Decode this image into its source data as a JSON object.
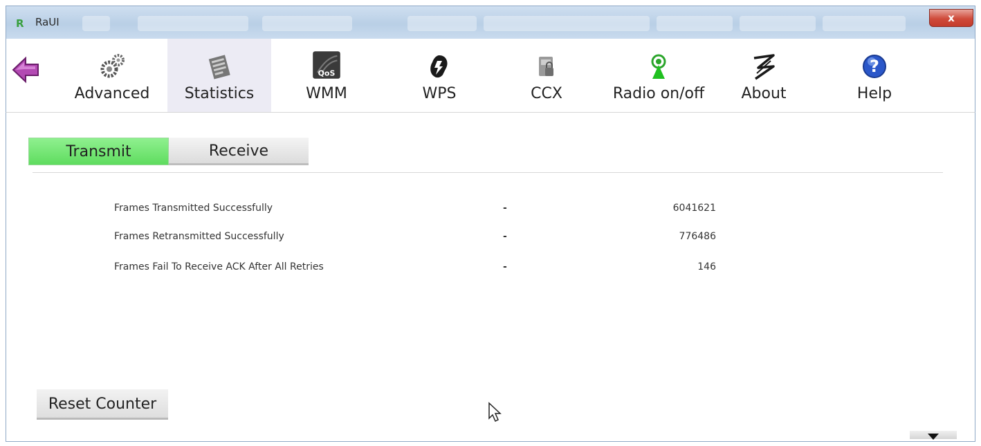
{
  "window": {
    "title": "RaUI",
    "close_label": "x"
  },
  "toolbar": {
    "items": [
      {
        "label": "Advanced",
        "icon": "gears-icon"
      },
      {
        "label": "Statistics",
        "icon": "statistics-icon",
        "active": true
      },
      {
        "label": "WMM",
        "icon": "qos-icon",
        "badge": "QoS"
      },
      {
        "label": "WPS",
        "icon": "wps-icon"
      },
      {
        "label": "CCX",
        "icon": "ccx-icon"
      },
      {
        "label": "Radio on/off",
        "icon": "radio-icon"
      },
      {
        "label": "About",
        "icon": "about-icon"
      },
      {
        "label": "Help",
        "icon": "help-icon",
        "glyph": "?"
      }
    ]
  },
  "subtabs": {
    "transmit": "Transmit",
    "receive": "Receive",
    "active": "transmit"
  },
  "stats": [
    {
      "label": "Frames Transmitted Successfully",
      "sep": "-",
      "value": "6041621"
    },
    {
      "label": "Frames Retransmitted Successfully",
      "sep": "-",
      "value": "776486"
    },
    {
      "label": "Frames Fail To Receive ACK After All Retries",
      "sep": "-",
      "value": "146"
    }
  ],
  "actions": {
    "reset_label": "Reset Counter"
  },
  "colors": {
    "active_tab": "#5fdc5f",
    "titlebar": "#b9cfe6",
    "close": "#cf4a3a",
    "back_arrow": "#b33fb3"
  }
}
